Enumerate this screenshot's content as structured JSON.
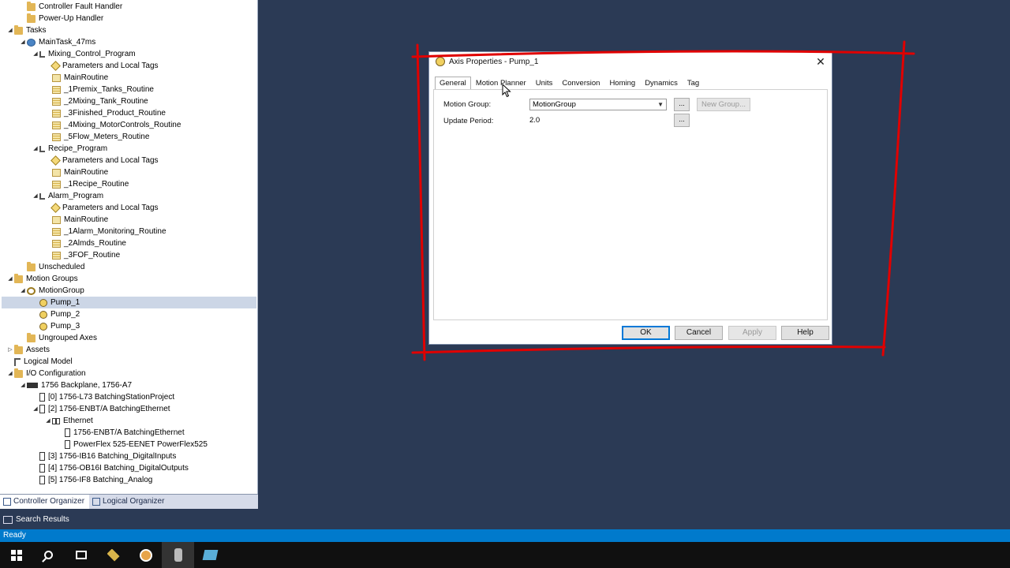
{
  "tree": [
    {
      "label": "Controller Fault Handler",
      "depth": 2,
      "icon": "folder",
      "expander": ""
    },
    {
      "label": "Power-Up Handler",
      "depth": 2,
      "icon": "folder",
      "expander": ""
    },
    {
      "label": "Tasks",
      "depth": 1,
      "icon": "folder",
      "expander": "open"
    },
    {
      "label": "MainTask_47ms",
      "depth": 2,
      "icon": "task",
      "expander": "open"
    },
    {
      "label": "Mixing_Control_Program",
      "depth": 3,
      "icon": "program",
      "expander": "open"
    },
    {
      "label": "Parameters and Local Tags",
      "depth": 4,
      "icon": "tag",
      "expander": ""
    },
    {
      "label": "MainRoutine",
      "depth": 4,
      "icon": "main",
      "expander": ""
    },
    {
      "label": "_1Premix_Tanks_Routine",
      "depth": 4,
      "icon": "routine",
      "expander": ""
    },
    {
      "label": "_2Mixing_Tank_Routine",
      "depth": 4,
      "icon": "routine",
      "expander": ""
    },
    {
      "label": "_3Finished_Product_Routine",
      "depth": 4,
      "icon": "routine",
      "expander": ""
    },
    {
      "label": "_4Mixing_MotorControls_Routine",
      "depth": 4,
      "icon": "routine",
      "expander": ""
    },
    {
      "label": "_5Flow_Meters_Routine",
      "depth": 4,
      "icon": "routine",
      "expander": ""
    },
    {
      "label": "Recipe_Program",
      "depth": 3,
      "icon": "program",
      "expander": "open"
    },
    {
      "label": "Parameters and Local Tags",
      "depth": 4,
      "icon": "tag",
      "expander": ""
    },
    {
      "label": "MainRoutine",
      "depth": 4,
      "icon": "main",
      "expander": ""
    },
    {
      "label": "_1Recipe_Routine",
      "depth": 4,
      "icon": "routine",
      "expander": ""
    },
    {
      "label": "Alarm_Program",
      "depth": 3,
      "icon": "program",
      "expander": "open"
    },
    {
      "label": "Parameters and Local Tags",
      "depth": 4,
      "icon": "tag",
      "expander": ""
    },
    {
      "label": "MainRoutine",
      "depth": 4,
      "icon": "main",
      "expander": ""
    },
    {
      "label": "_1Alarm_Monitoring_Routine",
      "depth": 4,
      "icon": "routine",
      "expander": ""
    },
    {
      "label": "_2Almds_Routine",
      "depth": 4,
      "icon": "routine",
      "expander": ""
    },
    {
      "label": "_3FOF_Routine",
      "depth": 4,
      "icon": "routine",
      "expander": ""
    },
    {
      "label": "Unscheduled",
      "depth": 2,
      "icon": "folder",
      "expander": ""
    },
    {
      "label": "Motion Groups",
      "depth": 1,
      "icon": "folder",
      "expander": "open"
    },
    {
      "label": "MotionGroup",
      "depth": 2,
      "icon": "motion",
      "expander": "open"
    },
    {
      "label": "Pump_1",
      "depth": 3,
      "icon": "axis",
      "expander": "",
      "selected": true
    },
    {
      "label": "Pump_2",
      "depth": 3,
      "icon": "axis",
      "expander": ""
    },
    {
      "label": "Pump_3",
      "depth": 3,
      "icon": "axis",
      "expander": ""
    },
    {
      "label": "Ungrouped Axes",
      "depth": 2,
      "icon": "folder",
      "expander": ""
    },
    {
      "label": "Assets",
      "depth": 1,
      "icon": "folder",
      "expander": "closed"
    },
    {
      "label": "Logical Model",
      "depth": 1,
      "icon": "logic",
      "expander": ""
    },
    {
      "label": "I/O Configuration",
      "depth": 1,
      "icon": "folder",
      "expander": "open"
    },
    {
      "label": "1756 Backplane, 1756-A7",
      "depth": 2,
      "icon": "chassis",
      "expander": "open"
    },
    {
      "label": "[0] 1756-L73 BatchingStationProject",
      "depth": 3,
      "icon": "module",
      "expander": ""
    },
    {
      "label": "[2] 1756-ENBT/A BatchingEthernet",
      "depth": 3,
      "icon": "module",
      "expander": "open"
    },
    {
      "label": "Ethernet",
      "depth": 4,
      "icon": "net",
      "expander": "open"
    },
    {
      "label": "1756-ENBT/A BatchingEthernet",
      "depth": 5,
      "icon": "module",
      "expander": ""
    },
    {
      "label": "PowerFlex 525-EENET PowerFlex525",
      "depth": 5,
      "icon": "module",
      "expander": ""
    },
    {
      "label": "[3] 1756-IB16 Batching_DigitalInputs",
      "depth": 3,
      "icon": "module",
      "expander": ""
    },
    {
      "label": "[4] 1756-OB16I Batching_DigitalOutputs",
      "depth": 3,
      "icon": "module",
      "expander": ""
    },
    {
      "label": "[5] 1756-IF8 Batching_Analog",
      "depth": 3,
      "icon": "module",
      "expander": ""
    }
  ],
  "organizer_tabs": [
    {
      "label": "Controller Organizer",
      "active": true
    },
    {
      "label": "Logical Organizer",
      "active": false
    }
  ],
  "search_results_label": "Search Results",
  "status": "Ready",
  "dialog": {
    "title": "Axis Properties - Pump_1",
    "close_glyph": "✕",
    "tabs": [
      "General",
      "Motion Planner",
      "Units",
      "Conversion",
      "Homing",
      "Dynamics",
      "Tag"
    ],
    "active_tab": "General",
    "motion_group_label": "Motion Group:",
    "motion_group_value": "MotionGroup",
    "update_period_label": "Update Period:",
    "update_period_value": "2.0",
    "ellipsis": "...",
    "new_group_label": "New Group...",
    "buttons": {
      "ok": "OK",
      "cancel": "Cancel",
      "apply": "Apply",
      "help": "Help"
    }
  },
  "colors": {
    "annotation": "#e00000",
    "accent": "#007acc",
    "desktop": "#2b3a55"
  }
}
